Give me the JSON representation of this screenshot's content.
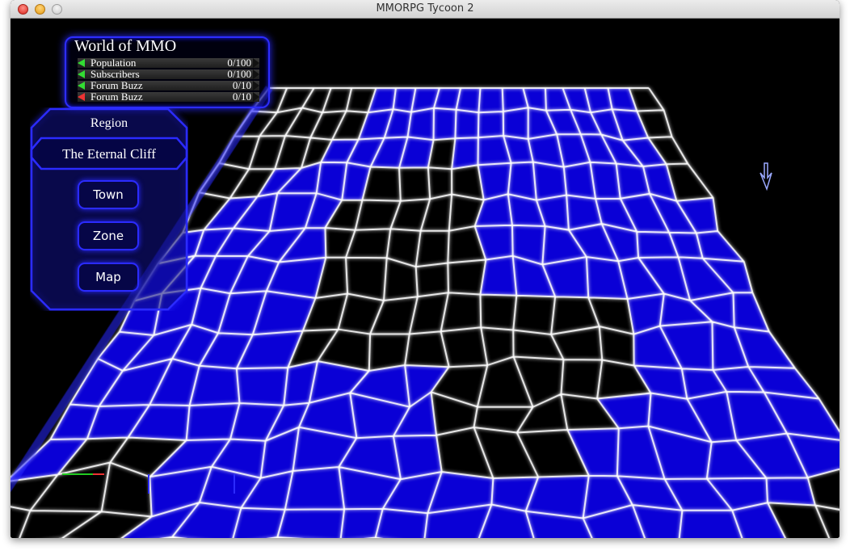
{
  "window": {
    "title": "MMORPG Tycoon 2"
  },
  "stats": {
    "title": "World of MMO",
    "rows": [
      {
        "label": "Population",
        "value": "0/100",
        "trend": "up"
      },
      {
        "label": "Subscribers",
        "value": "0/100",
        "trend": "up"
      },
      {
        "label": "Forum Buzz",
        "value": "0/10",
        "trend": "up"
      },
      {
        "label": "Forum Buzz",
        "value": "0/10",
        "trend": "down"
      }
    ]
  },
  "region": {
    "title": "Region",
    "name": "The Eternal Cliff",
    "buttons": [
      "Town",
      "Zone",
      "Map"
    ]
  },
  "colors": {
    "terrain": "#0a00d6",
    "grid": "#ffffff",
    "ui_border": "#2b2bff",
    "trend_up": "#33dd33",
    "trend_down": "#ee3333"
  }
}
